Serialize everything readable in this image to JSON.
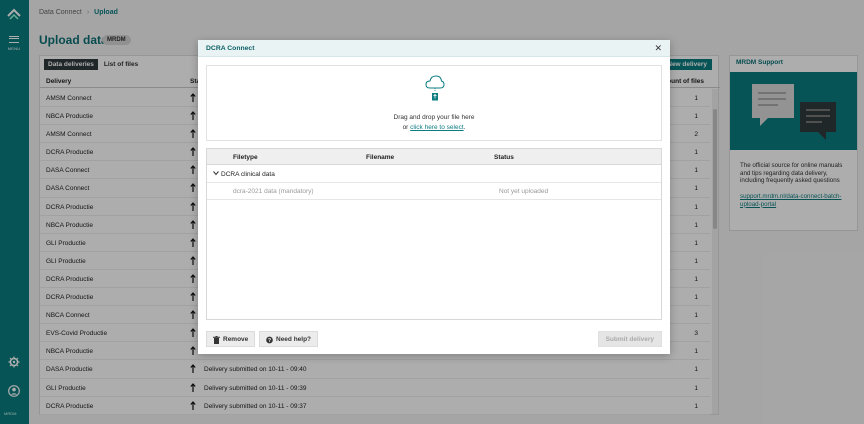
{
  "nav": {
    "menu_label": "MENU",
    "brand_label": "MRDM"
  },
  "breadcrumb": {
    "parent": "Data Connect",
    "current": "Upload"
  },
  "page": {
    "title": "Upload data",
    "badge": "MRDM"
  },
  "tabs": [
    {
      "label": "Data deliveries",
      "active": true
    },
    {
      "label": "List of files",
      "active": false
    }
  ],
  "new_delivery_label": "New delivery",
  "table": {
    "headers": {
      "delivery": "Delivery",
      "status": "Status",
      "amount": "Amount of files"
    },
    "rows": [
      {
        "delivery": "AMSM Connect",
        "message": "",
        "amount": "1"
      },
      {
        "delivery": "NBCA Productie",
        "message": "",
        "amount": "1"
      },
      {
        "delivery": "AMSM Connect",
        "message": "",
        "amount": "2"
      },
      {
        "delivery": "DCRA Productie",
        "message": "",
        "amount": "1"
      },
      {
        "delivery": "DASA Connect",
        "message": "",
        "amount": "1"
      },
      {
        "delivery": "DASA Connect",
        "message": "",
        "amount": "1"
      },
      {
        "delivery": "DCRA Productie",
        "message": "",
        "amount": "1"
      },
      {
        "delivery": "NBCA Productie",
        "message": "",
        "amount": "1"
      },
      {
        "delivery": "GLI Productie",
        "message": "",
        "amount": "1"
      },
      {
        "delivery": "GLI Productie",
        "message": "",
        "amount": "1"
      },
      {
        "delivery": "DCRA Productie",
        "message": "",
        "amount": "1"
      },
      {
        "delivery": "DCRA Productie",
        "message": "",
        "amount": "1"
      },
      {
        "delivery": "NBCA Connect",
        "message": "",
        "amount": "1"
      },
      {
        "delivery": "EVS-Covid Productie",
        "message": "",
        "amount": "3"
      },
      {
        "delivery": "NBCA Productie",
        "message": "",
        "amount": "1"
      },
      {
        "delivery": "DASA Productie",
        "message": "Delivery submitted on 10-11 - 09:40",
        "amount": "1"
      },
      {
        "delivery": "GLI Productie",
        "message": "Delivery submitted on 10-11 - 09:39",
        "amount": "1"
      },
      {
        "delivery": "DCRA Productie",
        "message": "Delivery submitted on 10-11 - 09:37",
        "amount": "1"
      }
    ]
  },
  "support": {
    "title": "MRDM Support",
    "text": "The official source for online manuals and tips regarding data delivery, including frequently asked questions",
    "link": "support.mrdm.nl/data-connect-batch-upload-portal"
  },
  "modal": {
    "title": "DCRA Connect",
    "close_glyph": "✕",
    "drop_line1": "Drag and drop your file here",
    "drop_or": "or ",
    "drop_link": "click here to select",
    "drop_end": ".",
    "headers": {
      "filetype": "Filetype",
      "filename": "Filename",
      "status": "Status"
    },
    "group": "DCRA clinical data",
    "files": [
      {
        "filetype": "dcra-2021 data (mandatory)",
        "filename": "",
        "status": "Not yet uploaded"
      }
    ],
    "buttons": {
      "remove": "Remove",
      "help": "Need help?",
      "submit": "Submit delivery"
    }
  },
  "colors": {
    "accent": "#0b7c80",
    "rail": "#0b7c80"
  },
  "icons": {
    "logo": "mrdm-logo-icon",
    "menu": "hamburger-icon",
    "settings": "gear-icon",
    "account": "user-icon",
    "upload": "cloud-upload-icon"
  }
}
